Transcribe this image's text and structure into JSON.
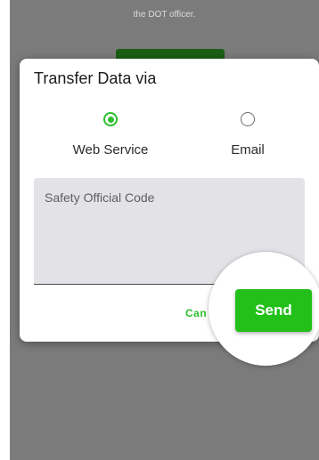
{
  "background": {
    "message": "the DOT officer."
  },
  "dialog": {
    "title": "Transfer Data via",
    "options": [
      {
        "label": "Web Service",
        "selected": true
      },
      {
        "label": "Email",
        "selected": false
      }
    ],
    "code_field": {
      "placeholder": "Safety Official Code",
      "value": ""
    },
    "cancel_label": "Can",
    "send_label": "Send"
  },
  "colors": {
    "accent": "#22c019",
    "overlay": "#7b7b7b"
  }
}
